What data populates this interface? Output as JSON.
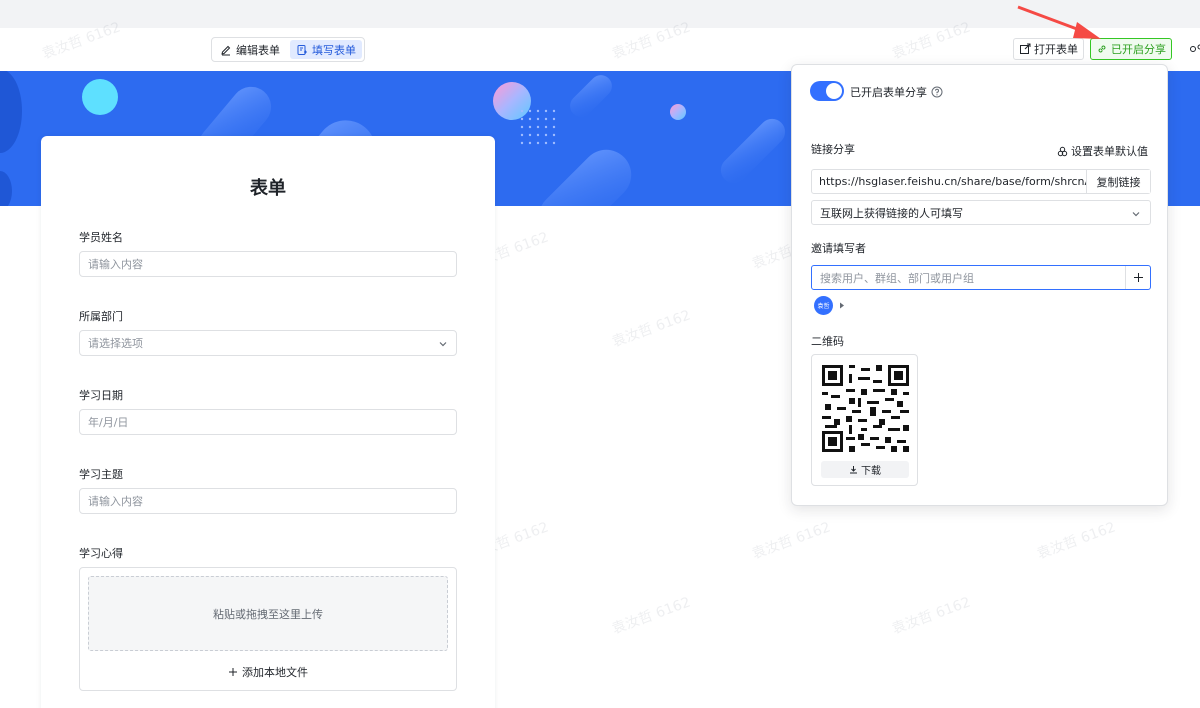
{
  "toolbar": {
    "edit_form": "编辑表单",
    "fill_form": "填写表单",
    "open_form": "打开表单",
    "sharing_enabled": "已开启分享"
  },
  "watermark": "袁汝哲 6162",
  "form": {
    "title": "表单",
    "fields": [
      {
        "label": "学员姓名",
        "placeholder": "请输入内容",
        "type": "text"
      },
      {
        "label": "所属部门",
        "placeholder": "请选择选项",
        "type": "select"
      },
      {
        "label": "学习日期",
        "placeholder": "年/月/日",
        "type": "date"
      },
      {
        "label": "学习主题",
        "placeholder": "请输入内容",
        "type": "text"
      },
      {
        "label": "学习心得",
        "type": "upload"
      }
    ],
    "upload": {
      "drop_text": "粘贴或拖拽至这里上传",
      "add_local": "添加本地文件"
    }
  },
  "share": {
    "toggle_label": "已开启表单分享",
    "toggle_on": true,
    "link_share_label": "链接分享",
    "set_default": "设置表单默认值",
    "url": "https://hsglaser.feishu.cn/share/base/form/shrcnAJbQ",
    "copy_link": "复制链接",
    "permission": "互联网上获得链接的人可填写",
    "invite_label": "邀请填写者",
    "invite_placeholder": "搜索用户、群组、部门或用户组",
    "avatar_text": "袁哲",
    "qr_label": "二维码",
    "download": "下载"
  },
  "colors": {
    "accent": "#3370ff",
    "banner": "#2d6bf0",
    "success": "#2ea121",
    "arrow": "#f54a45"
  }
}
